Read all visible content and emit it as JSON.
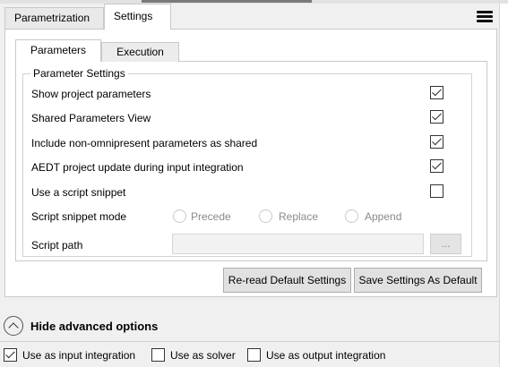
{
  "outer_tabs": [
    {
      "label": "Parametrization",
      "active": false
    },
    {
      "label": "Settings",
      "active": true
    }
  ],
  "inner_tabs": [
    {
      "label": "Parameters",
      "active": true
    },
    {
      "label": "Execution",
      "active": false
    }
  ],
  "group_title": "Parameter Settings",
  "settings": {
    "show_project_parameters": {
      "label": "Show project parameters",
      "checked": true
    },
    "shared_parameters_view": {
      "label": "Shared Parameters View",
      "checked": true
    },
    "include_non_omnipresent": {
      "label": "Include non-omnipresent parameters as shared",
      "checked": true
    },
    "aedt_project_update": {
      "label": "AEDT project update during input integration",
      "checked": true
    },
    "use_script_snippet": {
      "label": "Use a script snippet",
      "checked": false
    }
  },
  "script_snippet_mode": {
    "label": "Script snippet mode",
    "options": [
      "Precede",
      "Replace",
      "Append"
    ]
  },
  "script_path": {
    "label": "Script path",
    "value": "",
    "browse_label": "..."
  },
  "buttons": {
    "reread_default": "Re-read Default Settings",
    "save_default": "Save Settings As Default"
  },
  "advanced_toggle": "Hide advanced options",
  "usage": {
    "input_integration": {
      "label": "Use as input integration",
      "checked": true
    },
    "solver": {
      "label": "Use as solver",
      "checked": false
    },
    "output_integration": {
      "label": "Use as output integration",
      "checked": false
    }
  },
  "icons": {
    "menu": "hamburger-menu-icon",
    "collapse": "chevron-up-circle-icon"
  }
}
